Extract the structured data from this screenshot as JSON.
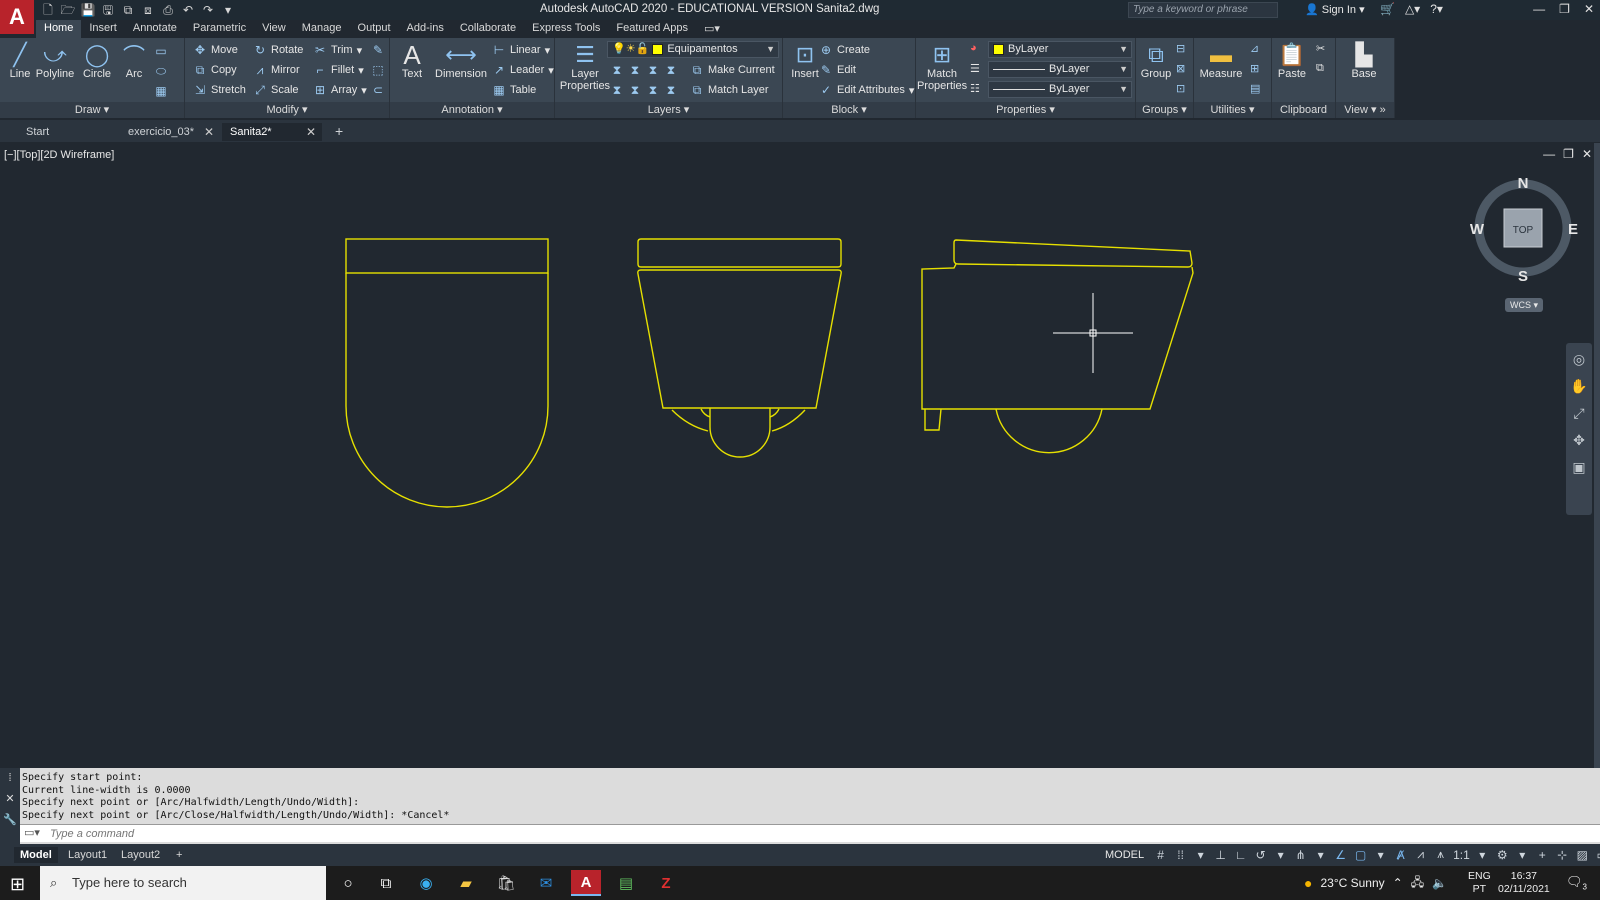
{
  "app": {
    "title": "Autodesk AutoCAD 2020 - EDUCATIONAL VERSION   Sanita2.dwg",
    "logo": "A",
    "search_placeholder": "Type a keyword or phrase",
    "sign_in": "Sign In"
  },
  "ribbon_tabs": [
    "Home",
    "Insert",
    "Annotate",
    "Parametric",
    "View",
    "Manage",
    "Output",
    "Add-ins",
    "Collaborate",
    "Express Tools",
    "Featured Apps"
  ],
  "draw": {
    "title": "Draw",
    "line": "Line",
    "polyline": "Polyline",
    "circle": "Circle",
    "arc": "Arc"
  },
  "modify": {
    "title": "Modify",
    "move": "Move",
    "rotate": "Rotate",
    "trim": "Trim",
    "copy": "Copy",
    "mirror": "Mirror",
    "fillet": "Fillet",
    "stretch": "Stretch",
    "scale": "Scale",
    "array": "Array"
  },
  "annotation": {
    "title": "Annotation",
    "text": "Text",
    "dimension": "Dimension",
    "linear": "Linear",
    "leader": "Leader",
    "table": "Table"
  },
  "layers": {
    "title": "Layers",
    "properties": "Layer Properties",
    "current": "Equipamentos",
    "make_current": "Make Current",
    "match_layer": "Match Layer"
  },
  "block": {
    "title": "Block",
    "insert": "Insert",
    "create": "Create",
    "edit": "Edit",
    "edit_attributes": "Edit Attributes"
  },
  "properties": {
    "title": "Properties",
    "match": "Match Properties",
    "color": "ByLayer",
    "linetype": "ByLayer",
    "lineweight": "ByLayer",
    "color_hex": "#ffff00"
  },
  "groups": {
    "title": "Groups",
    "group": "Group"
  },
  "utilities": {
    "title": "Utilities",
    "measure": "Measure"
  },
  "clipboard": {
    "title": "Clipboard",
    "paste": "Paste"
  },
  "view_panel": {
    "title": "View",
    "base": "Base"
  },
  "doc_tabs": [
    "Start",
    "exercicio_03*",
    "Sanita2*"
  ],
  "viewport_label": "[−][Top][2D Wireframe]",
  "viewcube": {
    "n": "N",
    "s": "S",
    "e": "E",
    "w": "W",
    "face": "TOP",
    "wcs": "WCS"
  },
  "command": {
    "history": [
      "Specify start point:",
      "Current line-width is 0.0000",
      "Specify next point or [Arc/Halfwidth/Length/Undo/Width]:",
      "Specify next point or [Arc/Close/Halfwidth/Length/Undo/Width]: *Cancel*"
    ],
    "placeholder": "Type a command"
  },
  "layout_tabs": [
    "Model",
    "Layout1",
    "Layout2"
  ],
  "status": {
    "model": "MODEL",
    "scale": "1:1"
  },
  "taskbar": {
    "search": "Type here to search",
    "weather": "23°C  Sunny",
    "lang1": "ENG",
    "lang2": "PT",
    "time": "16:37",
    "date": "02/11/2021",
    "notif_count": "3"
  },
  "colors": {
    "drawing_line": "#e6e000",
    "canvas_bg": "#212830",
    "ribbon_bg": "#3b4753",
    "accent_red": "#b8232b"
  }
}
